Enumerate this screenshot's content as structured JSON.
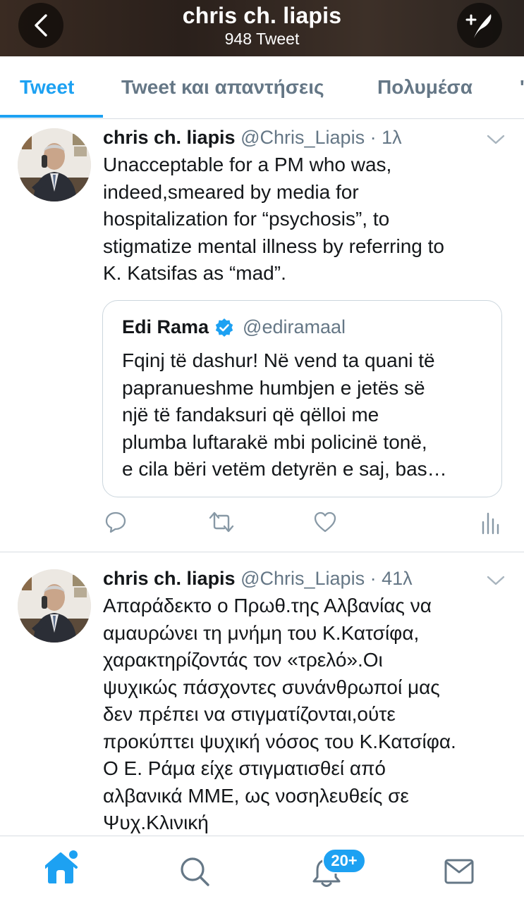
{
  "header": {
    "title": "chris ch. liapis",
    "subtitle": "948 Tweet",
    "back_icon": "chevron-left-icon",
    "compose_icon": "compose-tweet-icon"
  },
  "tabs": [
    {
      "label": "Tweet",
      "active": true
    },
    {
      "label": "Tweet και απαντήσεις",
      "active": false
    },
    {
      "label": "Πολυμέσα",
      "active": false
    },
    {
      "label": "'",
      "active": false
    }
  ],
  "tweets": [
    {
      "name": "chris ch. liapis",
      "meta": "@Chris_Liapis · 1λ",
      "lines": [
        "Unacceptable for a PM who was,",
        "indeed,smeared by media for",
        "hospitalization for “psychosis”, to",
        "stigmatize mental illness by referring to",
        "K. Katsifas as “mad”."
      ],
      "quote": {
        "name": "Edi Rama",
        "handle": "@ediramaal",
        "verified": true,
        "lines": [
          "Fqinj të dashur! Në vend ta quani të",
          "papranueshme humbjen e jetës së",
          "një të fandaksuri që qëlloi me",
          "plumba luftarakë mbi policinë tonë,",
          "e cila bëri vetëm detyrën e saj, bas…"
        ]
      }
    },
    {
      "name": "chris ch. liapis",
      "meta": "@Chris_Liapis · 41λ",
      "lines": [
        "Απαράδεκτο ο Πρωθ.της Αλβανίας να",
        "αμαυρώνει τη μνήμη του Κ.Κατσίφα,",
        "χαρακτηρίζοντάς τον «τρελό».Οι",
        "ψυχικώς πάσχοντες συνάνθρωποί μας",
        "δεν πρέπει να στιγματίζονται,ούτε",
        "προκύπτει ψυχική νόσος του Κ.Κατσίφα.",
        "Ο Ε. Ράμα είχε στιγματισθεί από",
        "αλβανικά ΜΜΕ, ως νοσηλευθείς σε",
        "Ψυχ.Κλινική"
      ]
    }
  ],
  "bottom_nav": {
    "notification_badge": "20+"
  },
  "colors": {
    "accent": "#1da1f2",
    "secondary_text": "#657786",
    "verified": "#1da1f2"
  }
}
